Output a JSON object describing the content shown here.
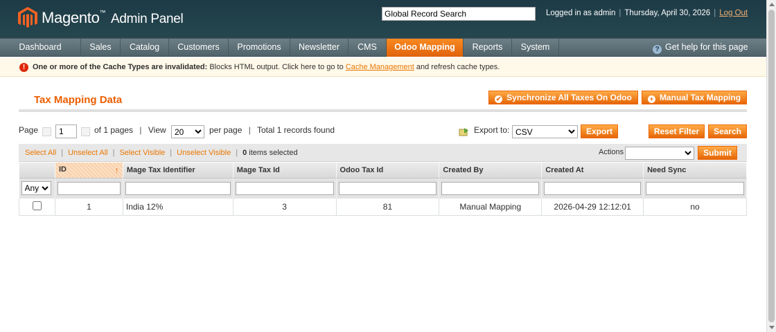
{
  "header": {
    "brand": "Magento",
    "brand_tm": "™",
    "brand_sub": "Admin Panel",
    "global_search": "Global Record Search",
    "logged_in": "Logged in as admin",
    "date": "Thursday, April 30, 2026",
    "logout": "Log Out"
  },
  "nav": {
    "items": [
      {
        "label": "Dashboard"
      },
      {
        "label": "Sales"
      },
      {
        "label": "Catalog"
      },
      {
        "label": "Customers"
      },
      {
        "label": "Promotions"
      },
      {
        "label": "Newsletter"
      },
      {
        "label": "CMS"
      },
      {
        "label": "Odoo Mapping",
        "active": true
      },
      {
        "label": "Reports"
      },
      {
        "label": "System"
      }
    ],
    "help": "Get help for this page"
  },
  "notice": {
    "bold": "One or more of the Cache Types are invalidated:",
    "text1": " Blocks HTML output. Click here to go to ",
    "link": "Cache Management",
    "text2": " and refresh cache types."
  },
  "page": {
    "title": "Tax Mapping Data",
    "sync_button": "Synchronize All Taxes On Odoo",
    "manual_button": "Manual Tax Mapping"
  },
  "pager": {
    "page_label": "Page",
    "page_value": "1",
    "of_pages": "of 1 pages",
    "view_label": "View",
    "view_value": "20",
    "per_page": "per page",
    "total": "Total 1 records found",
    "export_label": "Export to:",
    "export_value": "CSV",
    "export_button": "Export",
    "reset_button": "Reset Filter",
    "search_button": "Search"
  },
  "massaction": {
    "select_all": "Select All",
    "unselect_all": "Unselect All",
    "select_visible": "Select Visible",
    "unselect_visible": "Unselect Visible",
    "count": "0",
    "items_selected": " items selected",
    "actions_label": "Actions",
    "submit": "Submit"
  },
  "grid": {
    "columns": [
      "ID",
      "Mage Tax Identifier",
      "Mage Tax Id",
      "Odoo Tax Id",
      "Created By",
      "Created At",
      "Need Sync"
    ],
    "sort_arrow": "↑",
    "filter_any": "Any",
    "rows": [
      {
        "id": "1",
        "identifier": "India 12%",
        "mage_id": "3",
        "odoo_id": "81",
        "created_by": "Manual Mapping",
        "created_at": "2026-04-29 12:12:01",
        "need_sync": "no"
      }
    ]
  },
  "colors": {
    "accent": "#eb5e00",
    "header_bg": "#1d3a46",
    "nav_active": "#f88a21"
  }
}
